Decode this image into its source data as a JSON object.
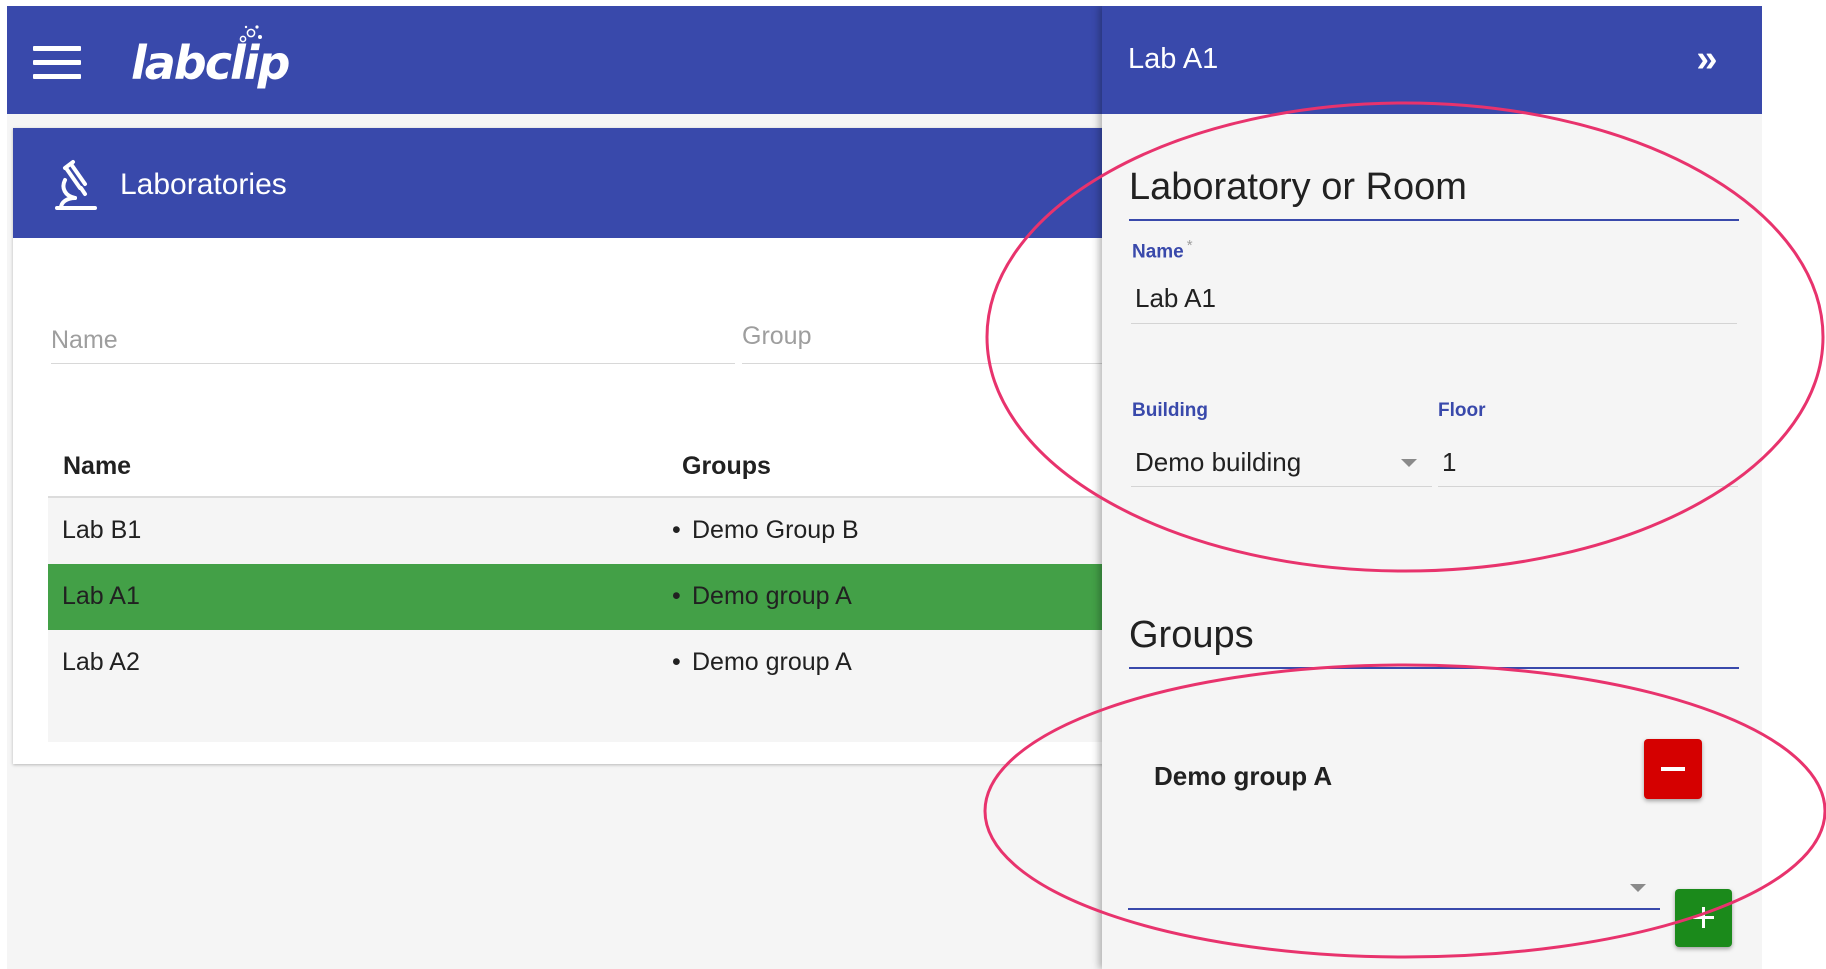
{
  "app": {
    "logo_text": "labclip",
    "menu_icon": "hamburger-menu-icon"
  },
  "laboratories": {
    "icon": "microscope-icon",
    "title": "Laboratories",
    "filters": {
      "name_placeholder": "Name",
      "group_placeholder": "Group"
    },
    "table": {
      "columns": [
        "Name",
        "Groups"
      ],
      "rows": [
        {
          "name": "Lab B1",
          "group": "Demo Group B"
        },
        {
          "name": "Lab A1",
          "group": "Demo group A"
        },
        {
          "name": "Lab A2",
          "group": "Demo group A"
        }
      ],
      "selected_row": 1
    }
  },
  "panel": {
    "title": "Lab A1",
    "collapse_label": "»",
    "section_room": "Laboratory or Room",
    "name_label": "Name",
    "name_required_mark": "*",
    "name_value": "Lab A1",
    "building_label": "Building",
    "building_value": "Demo building",
    "floor_label": "Floor",
    "floor_value": "1",
    "section_groups": "Groups",
    "groups": [
      "Demo group A"
    ],
    "add_group_value": ""
  },
  "colors": {
    "primary": "#3949ab",
    "selected_row": "#43a047",
    "remove_button": "#d50000",
    "add_button": "#1b8a1b",
    "annotation": "#e8336d"
  }
}
